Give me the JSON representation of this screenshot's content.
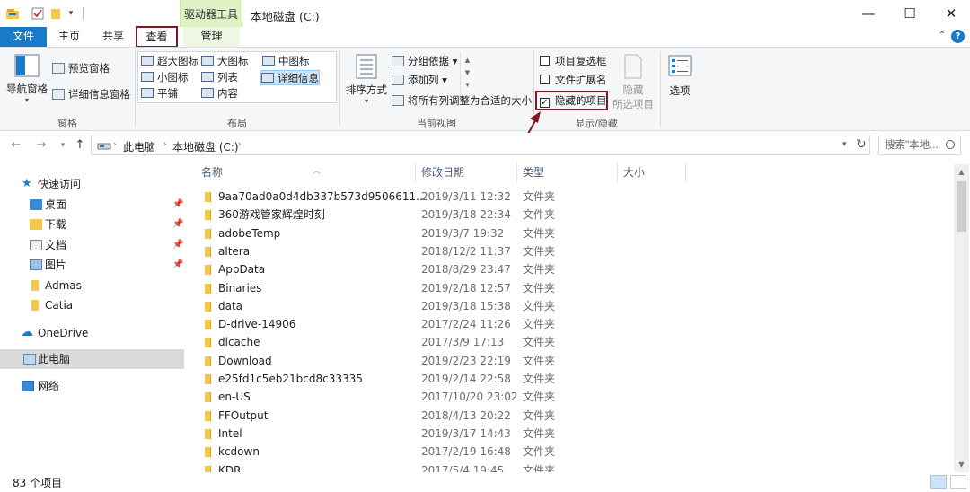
{
  "titlebar": {
    "context_tab": "驱动器工具",
    "window_title": "本地磁盘 (C:)",
    "minimize": "—",
    "maximize": "☐",
    "close": "✕",
    "quick_access_dropdown": "▾"
  },
  "tabs": {
    "file": "文件",
    "home": "主页",
    "share": "共享",
    "view": "查看",
    "manage": "管理",
    "collapse": "⌃",
    "help": "?"
  },
  "ribbon": {
    "panes": {
      "nav_pane": "导航窗格",
      "preview_pane": "预览窗格",
      "details_pane": "详细信息窗格",
      "group": "窗格"
    },
    "layout": {
      "extra_large": "超大图标",
      "large": "大图标",
      "medium": "中图标",
      "small": "小图标",
      "list": "列表",
      "details": "详细信息",
      "tiles": "平铺",
      "content": "内容",
      "group": "布局"
    },
    "current_view": {
      "sort_by": "排序方式",
      "group_by": "分组依据",
      "add_columns": "添加列",
      "size_all_columns": "将所有列调整为合适的大小",
      "group": "当前视图"
    },
    "show_hide": {
      "item_checkboxes": "项目复选框",
      "file_extensions": "文件扩展名",
      "hidden_items": "隐藏的项目",
      "hidden_items_checked": true,
      "hide_selected_line1": "隐藏",
      "hide_selected_line2": "所选项目",
      "group": "显示/隐藏"
    },
    "options": "选项"
  },
  "address": {
    "breadcrumb": [
      "此电脑",
      "本地磁盘 (C:)"
    ],
    "search_placeholder": "搜索\"本地..."
  },
  "navpane": {
    "quick_access": "快速访问",
    "items": [
      {
        "label": "桌面",
        "pinned": true
      },
      {
        "label": "下载",
        "pinned": true
      },
      {
        "label": "文档",
        "pinned": true
      },
      {
        "label": "图片",
        "pinned": true
      },
      {
        "label": "Admas",
        "pinned": false
      },
      {
        "label": "Catia",
        "pinned": false
      }
    ],
    "onedrive": "OneDrive",
    "this_pc": "此电脑",
    "network": "网络"
  },
  "filelist": {
    "columns": [
      "名称",
      "修改日期",
      "类型",
      "大小"
    ],
    "rows": [
      {
        "name": "9aa70ad0a0d4db337b573d9506611...",
        "date": "2019/3/11 12:32",
        "type": "文件夹"
      },
      {
        "name": "360游戏管家辉煌时刻",
        "date": "2019/3/18 22:34",
        "type": "文件夹"
      },
      {
        "name": "adobeTemp",
        "date": "2019/3/7 19:32",
        "type": "文件夹"
      },
      {
        "name": "altera",
        "date": "2018/12/2 11:37",
        "type": "文件夹"
      },
      {
        "name": "AppData",
        "date": "2018/8/29 23:47",
        "type": "文件夹"
      },
      {
        "name": "Binaries",
        "date": "2019/2/18 12:57",
        "type": "文件夹"
      },
      {
        "name": "data",
        "date": "2019/3/18 15:38",
        "type": "文件夹"
      },
      {
        "name": "D-drive-14906",
        "date": "2017/2/24 11:26",
        "type": "文件夹"
      },
      {
        "name": "dlcache",
        "date": "2017/3/9 17:13",
        "type": "文件夹"
      },
      {
        "name": "Download",
        "date": "2019/2/23 22:19",
        "type": "文件夹"
      },
      {
        "name": "e25fd1c5eb21bcd8c33335",
        "date": "2019/2/14 22:58",
        "type": "文件夹"
      },
      {
        "name": "en-US",
        "date": "2017/10/20 23:02",
        "type": "文件夹"
      },
      {
        "name": "FFOutput",
        "date": "2018/4/13 20:22",
        "type": "文件夹"
      },
      {
        "name": "Intel",
        "date": "2019/3/17 14:43",
        "type": "文件夹"
      },
      {
        "name": "kcdown",
        "date": "2017/2/19 16:48",
        "type": "文件夹"
      },
      {
        "name": "KDR",
        "date": "2017/5/4 19:45",
        "type": "文件夹"
      }
    ]
  },
  "status": {
    "count": "83 个项目"
  },
  "colors": {
    "accent": "#1979ca",
    "highlight_border": "#7b1a22",
    "folder": "#f4c94b",
    "context_tab": "#dff2c6"
  }
}
